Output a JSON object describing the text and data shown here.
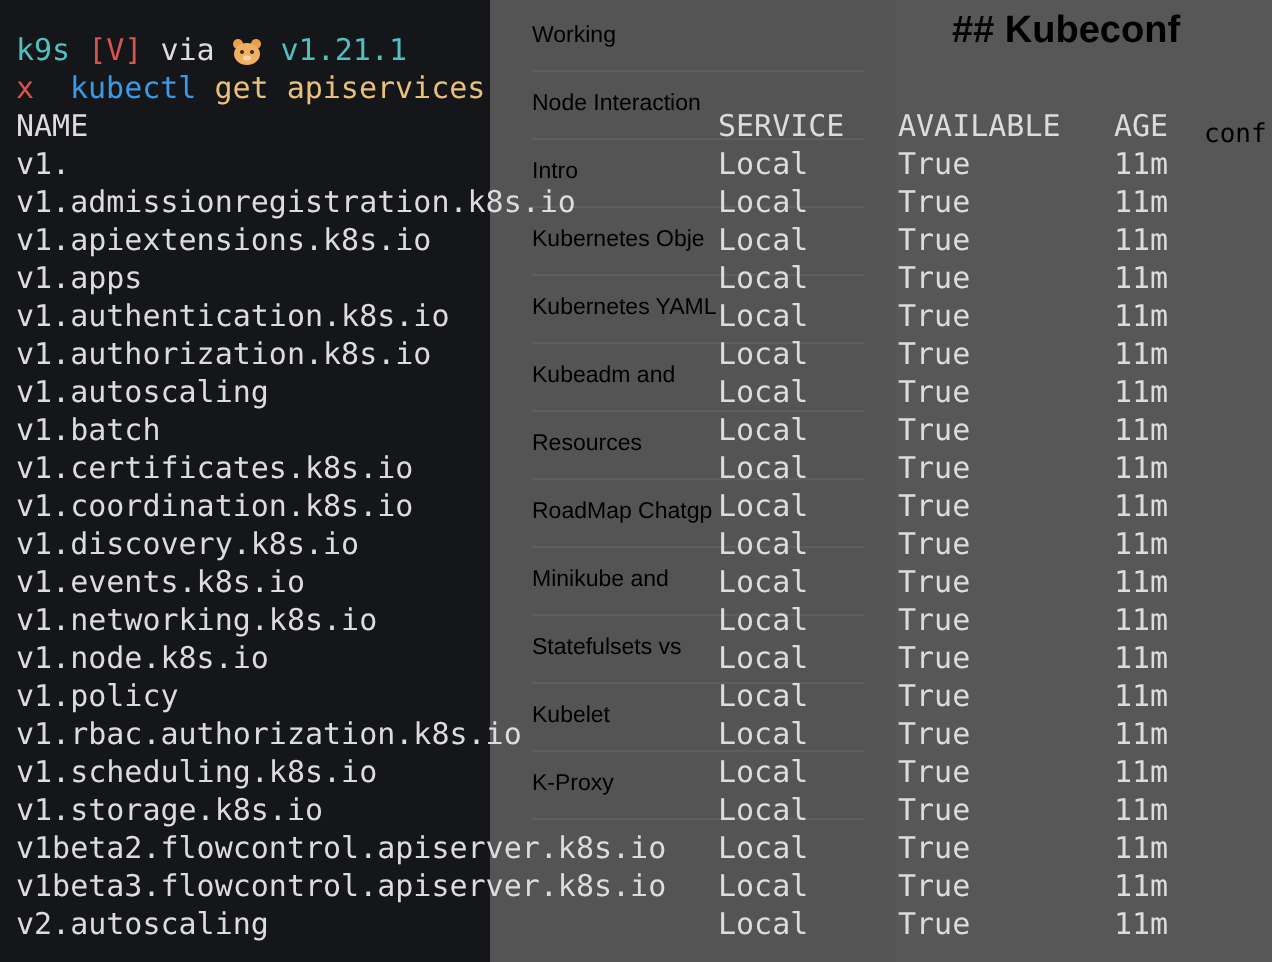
{
  "notes_list": {
    "items": [
      "Working",
      "Node Interaction",
      "Intro",
      "Kubernetes Obje",
      "Kubernetes YAML",
      "Kubeadm and",
      "Resources",
      "RoadMap Chatgp",
      "Minikube and",
      "Statefulsets vs",
      "Kubelet",
      "K-Proxy"
    ]
  },
  "editor": {
    "heading": "## Kubeconf",
    "code": "conf"
  },
  "terminal": {
    "prompt": {
      "directory": "k9s",
      "git_status": "[V]",
      "via": "via",
      "version": "v1.21.1"
    },
    "command": {
      "symbol": "x",
      "program": "kubectl",
      "args": "get apiservices"
    },
    "columns": [
      "NAME",
      "SERVICE",
      "AVAILABLE",
      "AGE"
    ],
    "rows": [
      [
        "v1.",
        "Local",
        "True",
        "11m"
      ],
      [
        "v1.admissionregistration.k8s.io",
        "Local",
        "True",
        "11m"
      ],
      [
        "v1.apiextensions.k8s.io",
        "Local",
        "True",
        "11m"
      ],
      [
        "v1.apps",
        "Local",
        "True",
        "11m"
      ],
      [
        "v1.authentication.k8s.io",
        "Local",
        "True",
        "11m"
      ],
      [
        "v1.authorization.k8s.io",
        "Local",
        "True",
        "11m"
      ],
      [
        "v1.autoscaling",
        "Local",
        "True",
        "11m"
      ],
      [
        "v1.batch",
        "Local",
        "True",
        "11m"
      ],
      [
        "v1.certificates.k8s.io",
        "Local",
        "True",
        "11m"
      ],
      [
        "v1.coordination.k8s.io",
        "Local",
        "True",
        "11m"
      ],
      [
        "v1.discovery.k8s.io",
        "Local",
        "True",
        "11m"
      ],
      [
        "v1.events.k8s.io",
        "Local",
        "True",
        "11m"
      ],
      [
        "v1.networking.k8s.io",
        "Local",
        "True",
        "11m"
      ],
      [
        "v1.node.k8s.io",
        "Local",
        "True",
        "11m"
      ],
      [
        "v1.policy",
        "Local",
        "True",
        "11m"
      ],
      [
        "v1.rbac.authorization.k8s.io",
        "Local",
        "True",
        "11m"
      ],
      [
        "v1.scheduling.k8s.io",
        "Local",
        "True",
        "11m"
      ],
      [
        "v1.storage.k8s.io",
        "Local",
        "True",
        "11m"
      ],
      [
        "v1beta2.flowcontrol.apiserver.k8s.io",
        "Local",
        "True",
        "11m"
      ],
      [
        "v1beta3.flowcontrol.apiserver.k8s.io",
        "Local",
        "True",
        "11m"
      ],
      [
        "v2.autoscaling",
        "Local",
        "True",
        "11m"
      ]
    ]
  }
}
